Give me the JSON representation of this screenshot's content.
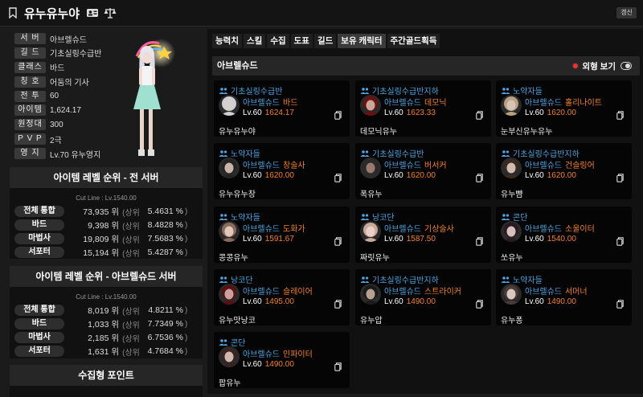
{
  "header": {
    "name": "유누유누야",
    "refresh_label": "갱신"
  },
  "profile": {
    "rows": [
      {
        "label": "서 버",
        "value": "아브렐슈드"
      },
      {
        "label": "길 드",
        "value": "기초실링수급반"
      },
      {
        "label": "클래스",
        "value": "바드"
      },
      {
        "label": "칭 호",
        "value": "어둠의 기사"
      },
      {
        "label": "전 투",
        "value": "60"
      },
      {
        "label": "아이템",
        "value": "1,624.17"
      },
      {
        "label": "원정대",
        "value": "300"
      },
      {
        "label": "P V P",
        "value": "2극"
      },
      {
        "label": "영 지",
        "value": "Lv.70 유누영지"
      }
    ]
  },
  "rank_all": {
    "title": "아이템 레벨 순위 - 전 서버",
    "cutline": "Cut Line : Lv.1540.00",
    "rows": [
      {
        "label": "전체 통합",
        "num": "73,935 위",
        "sub": "(상위",
        "pct": "5.4631 %",
        "close": ")"
      },
      {
        "label": "바드",
        "num": "9,398 위",
        "sub": "(상위",
        "pct": "8.4828 %",
        "close": ")"
      },
      {
        "label": "마법사",
        "num": "19,809 위",
        "sub": "(상위",
        "pct": "7.5683 %",
        "close": ")"
      },
      {
        "label": "서포터",
        "num": "15,194 위",
        "sub": "(상위",
        "pct": "5.4287 %",
        "close": ")"
      }
    ]
  },
  "rank_server": {
    "title": "아이템 레벨 순위 - 아브렐슈드 서버",
    "cutline": "Cut Line : Lv.1540.00",
    "rows": [
      {
        "label": "전체 통합",
        "num": "8,019 위",
        "sub": "(상위",
        "pct": "4.8211 %",
        "close": ")"
      },
      {
        "label": "바드",
        "num": "1,033 위",
        "sub": "(상위",
        "pct": "7.7349 %",
        "close": ")"
      },
      {
        "label": "마법사",
        "num": "2,185 위",
        "sub": "(상위",
        "pct": "6.7536 %",
        "close": ")"
      },
      {
        "label": "서포터",
        "num": "1,631 위",
        "sub": "(상위",
        "pct": "4.7684 %",
        "close": ")"
      }
    ]
  },
  "collect": {
    "title": "수집형 포인트"
  },
  "tabs": [
    "능력치",
    "스킬",
    "수집",
    "도표",
    "길드",
    "보유 캐릭터",
    "주간골드획득"
  ],
  "server_section": {
    "name": "아브렐슈드",
    "view_label": "외형 보기"
  },
  "characters": [
    {
      "guild": "기초실링수급반",
      "server": "아브렐슈드",
      "cls": "바드",
      "lv": "Lv.60",
      "ilvl": "1624.17",
      "name": "유누유누야",
      "skin": "#d8d0cc",
      "hair": "#cfcfd6"
    },
    {
      "guild": "기초실링수급반지하",
      "server": "아브렐슈드",
      "cls": "데모닉",
      "lv": "Lv.60",
      "ilvl": "1623.33",
      "name": "데모닉유누",
      "skin": "#c9a89a",
      "hair": "#6b1010"
    },
    {
      "guild": "노약자들",
      "server": "아브렐슈드",
      "cls": "홀리나이트",
      "lv": "Lv.60",
      "ilvl": "1620.00",
      "name": "눈부신유누유누",
      "skin": "#d8c4b4",
      "hair": "#b8a080"
    },
    {
      "guild": "노약자들",
      "server": "아브렐슈드",
      "cls": "창술사",
      "lv": "Lv.60",
      "ilvl": "1620.00",
      "name": "유누유누창",
      "skin": "#c8b4a8",
      "hair": "#222"
    },
    {
      "guild": "기초실링수급반",
      "server": "아브렐슈드",
      "cls": "버서커",
      "lv": "Lv.60",
      "ilvl": "1620.00",
      "name": "폭유누",
      "skin": "#9a7a6a",
      "hair": "#2a2a2a"
    },
    {
      "guild": "기초실링수급반지하",
      "server": "아브렐슈드",
      "cls": "건슬링어",
      "lv": "Lv.60",
      "ilvl": "1620.00",
      "name": "유누뺨",
      "skin": "#d0bcb0",
      "hair": "#3a2a20"
    },
    {
      "guild": "노약자들",
      "server": "아브렐슈드",
      "cls": "도화가",
      "lv": "Lv.60",
      "ilvl": "1591.67",
      "name": "콩콩유누",
      "skin": "#e0c8bc",
      "hair": "#8a6a5a"
    },
    {
      "guild": "낭코단",
      "server": "아브렐슈드",
      "cls": "기상술사",
      "lv": "Lv.60",
      "ilvl": "1587.50",
      "name": "짜릿유누",
      "skin": "#e8d0c8",
      "hair": "#c8a898"
    },
    {
      "guild": "콘단",
      "server": "아브렐슈드",
      "cls": "소울이터",
      "lv": "Lv.60",
      "ilvl": "1540.00",
      "name": "쏘유누",
      "skin": "#d8c0c0",
      "hair": "#2a1a20"
    },
    {
      "guild": "낭코단",
      "server": "아브렐슈드",
      "cls": "슬레이어",
      "lv": "Lv.60",
      "ilvl": "1495.00",
      "name": "유누맛낭코",
      "skin": "#c8a0a0",
      "hair": "#5a1010"
    },
    {
      "guild": "기초실링수급반지하",
      "server": "아브렐슈드",
      "cls": "스트라이커",
      "lv": "Lv.60",
      "ilvl": "1490.00",
      "name": "유누압",
      "skin": "#b8a090",
      "hair": "#1a1a1a"
    },
    {
      "guild": "노약자들",
      "server": "아브렐슈드",
      "cls": "서머너",
      "lv": "Lv.60",
      "ilvl": "1490.00",
      "name": "유누퐁",
      "skin": "#d8c8c0",
      "hair": "#4a3a38"
    },
    {
      "guild": "콘단",
      "server": "아브렐슈드",
      "cls": "인파이터",
      "lv": "Lv.60",
      "ilvl": "1490.00",
      "name": "팝유누",
      "skin": "#d0b8b0",
      "hair": "#3a2420"
    }
  ]
}
